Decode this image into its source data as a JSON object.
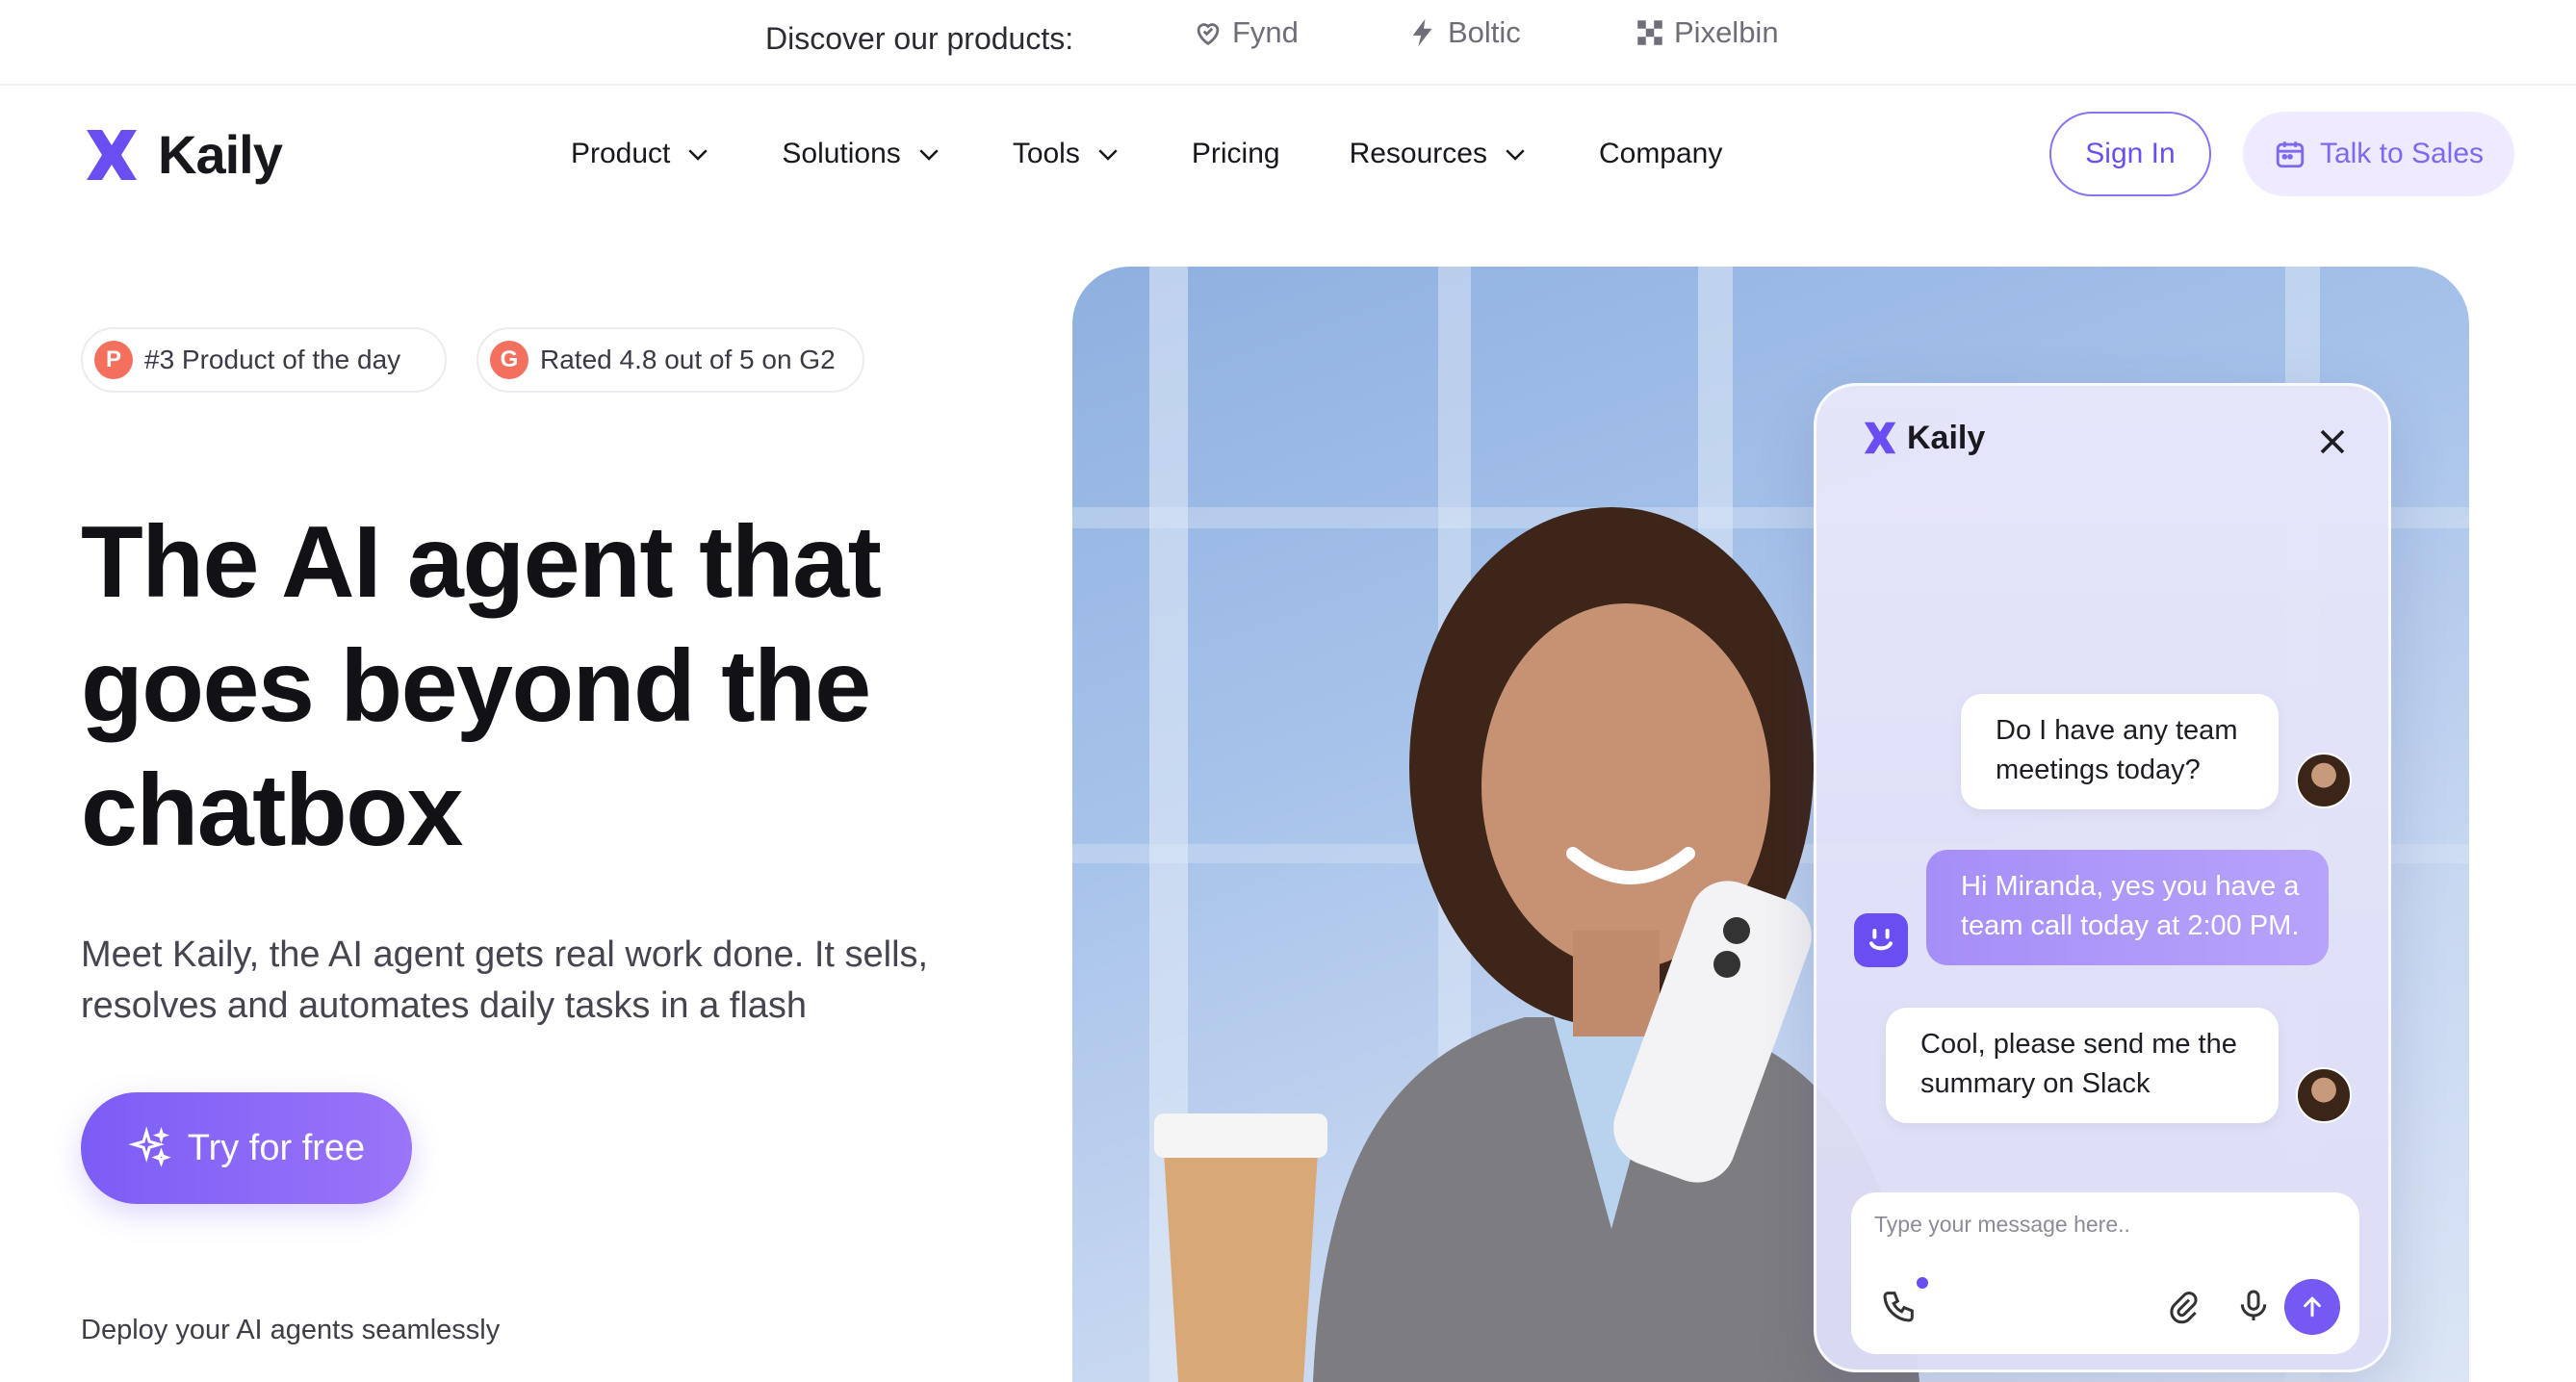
{
  "topbar": {
    "discover": "Discover our products:",
    "products": [
      {
        "label": "Fynd",
        "icon": "fynd-heart-icon"
      },
      {
        "label": "Boltic",
        "icon": "boltic-bolt-icon"
      },
      {
        "label": "Pixelbin",
        "icon": "pixelbin-icon"
      }
    ]
  },
  "brand": {
    "name": "Kaily",
    "accent": "#6b4ef2"
  },
  "nav": {
    "items": [
      {
        "label": "Product",
        "dropdown": true
      },
      {
        "label": "Solutions",
        "dropdown": true
      },
      {
        "label": "Tools",
        "dropdown": true
      },
      {
        "label": "Pricing",
        "dropdown": false
      },
      {
        "label": "Resources",
        "dropdown": true
      },
      {
        "label": "Company",
        "dropdown": false
      }
    ],
    "sign_in": "Sign In",
    "talk_to_sales": "Talk to Sales"
  },
  "hero": {
    "badges": [
      {
        "icon_letter": "P",
        "label": "#3 Product of the day"
      },
      {
        "icon_letter": "G",
        "label": "Rated 4.8 out of 5 on G2"
      }
    ],
    "title_lines": [
      "The AI agent that",
      "goes beyond the",
      "chatbox"
    ],
    "subtitle_lines": [
      "Meet Kaily, the AI agent gets real work done. It sells,",
      "resolves and automates daily tasks in a flash"
    ],
    "cta": "Try for free",
    "deploy": "Deploy your AI agents seamlessly"
  },
  "chat": {
    "brand": "Kaily",
    "messages": [
      {
        "from": "user",
        "text": "Do I have any team meetings today?"
      },
      {
        "from": "bot",
        "text": "Hi Miranda, yes you have a team call today at 2:00 PM."
      },
      {
        "from": "user",
        "text": "Cool, please send me the summary on Slack"
      }
    ],
    "input_placeholder": "Type your message here.."
  }
}
